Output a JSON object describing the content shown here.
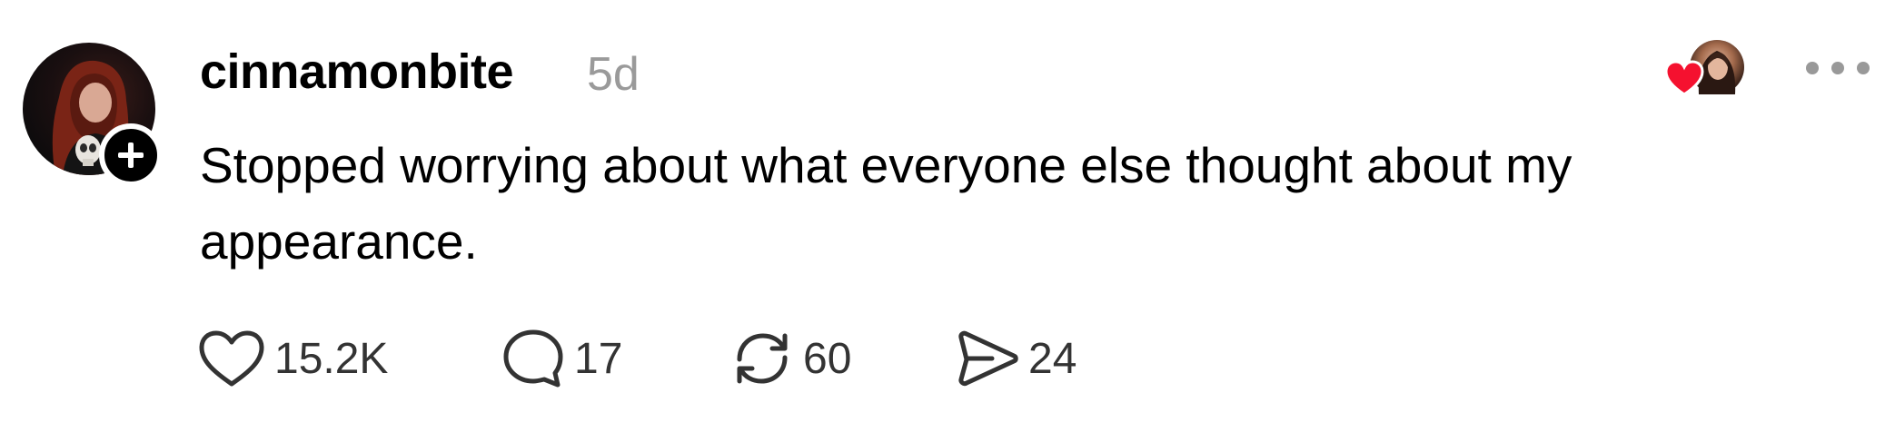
{
  "post": {
    "username": "cinnamonbite",
    "timestamp": "5d",
    "text": "Stopped worrying about what everyone else thought about my appearance."
  },
  "actions": {
    "likes": "15.2K",
    "replies": "17",
    "reposts": "60",
    "shares": "24"
  },
  "icons": {
    "avatar": "user-avatar-photo",
    "follow": "plus-icon",
    "reaction": "heart-icon",
    "more": "more-horizontal-icon",
    "like": "heart-outline-icon",
    "reply": "speech-bubble-icon",
    "repost": "repost-arrows-icon",
    "share": "paper-plane-icon"
  },
  "colors": {
    "heart": "#f5112f",
    "muted": "#9a9a9a",
    "text": "#000000"
  }
}
